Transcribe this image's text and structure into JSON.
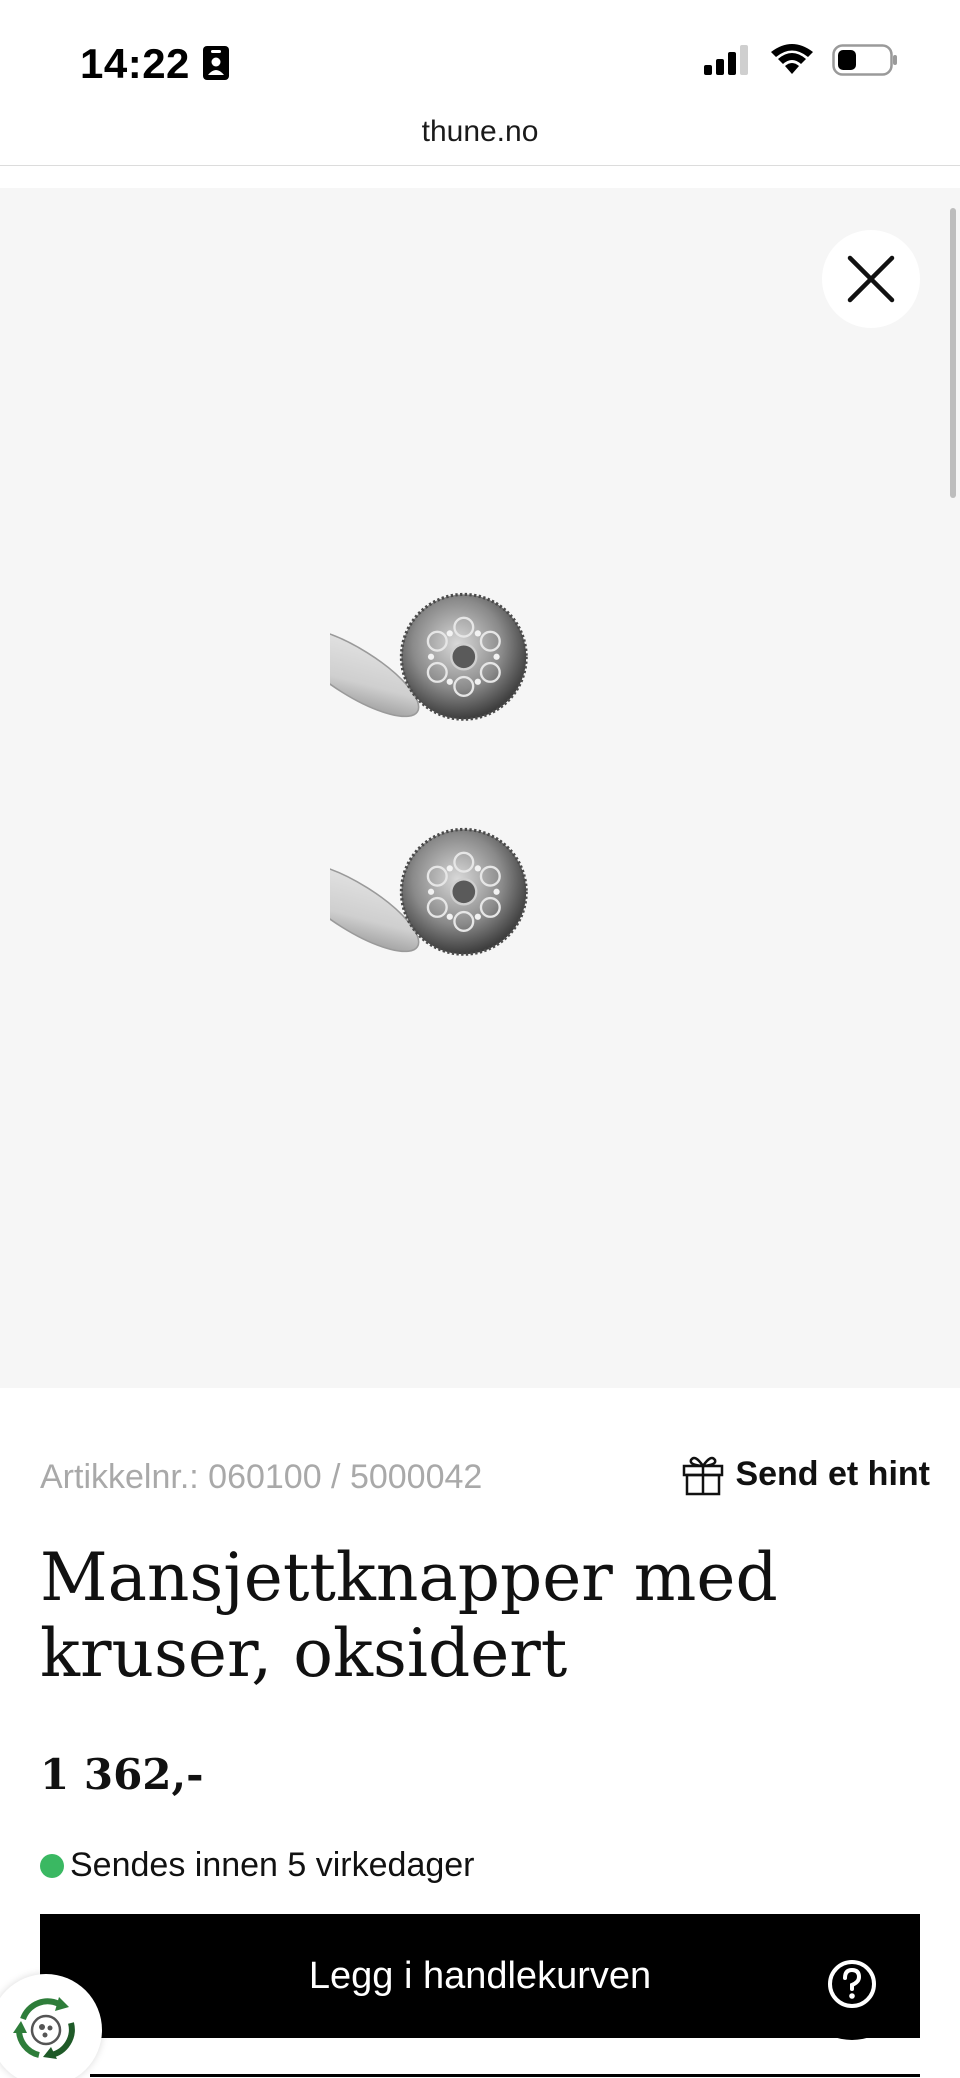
{
  "status_bar": {
    "time": "14:22",
    "icons": [
      "id-card-icon",
      "signal-icon",
      "wifi-icon",
      "battery-icon"
    ]
  },
  "browser": {
    "url": "thune.no"
  },
  "product": {
    "sku": "Artikkelnr.: 060100 / 5000042",
    "hint_label": "Send et hint",
    "title": "Mansjettknapper med kruser, oksidert",
    "price": "1 362,-",
    "stock_text": "Sendes innen 5 virkedager",
    "add_to_cart_label": "Legg i handlekurven"
  },
  "colors": {
    "stock_indicator": "#3ab862",
    "button_background": "#000000",
    "image_background": "#f6f6f6"
  }
}
